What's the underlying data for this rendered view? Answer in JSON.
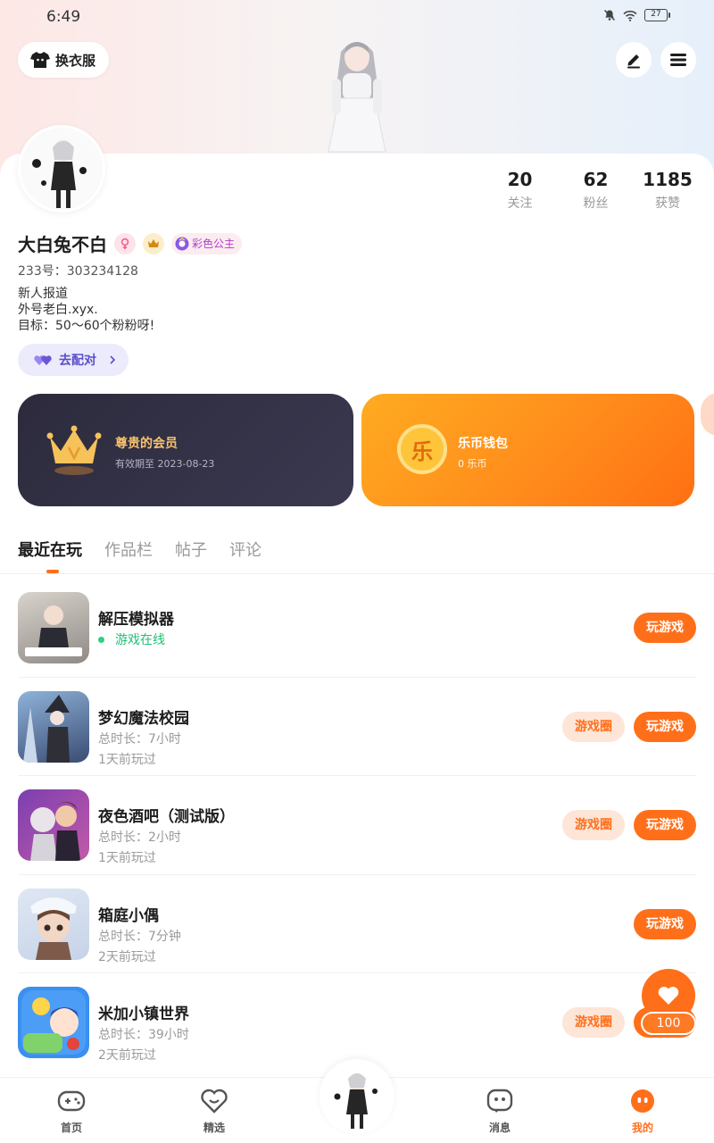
{
  "status_bar": {
    "time": "6:49",
    "battery": "27"
  },
  "header": {
    "outfit_label": "换衣服"
  },
  "profile": {
    "stats": [
      {
        "num": "20",
        "label": "关注"
      },
      {
        "num": "62",
        "label": "粉丝"
      },
      {
        "num": "1185",
        "label": "获赞"
      }
    ],
    "username": "大白兔不白",
    "princess_badge": "彩色公主",
    "uid": "233号：303234128",
    "bio": [
      "新人报道",
      "外号老白.xyx.",
      "目标：50～60个粉粉呀!"
    ],
    "pair_label": "去配对"
  },
  "cards": {
    "vip": {
      "title": "尊贵的会员",
      "sub": "有效期至 2023-08-23"
    },
    "wallet": {
      "title": "乐币钱包",
      "sub": "0 乐币",
      "coin_char": "乐"
    }
  },
  "tabs": [
    "最近在玩",
    "作品栏",
    "帖子",
    "评论"
  ],
  "games": [
    {
      "name": "解压模拟器",
      "online": "游戏在线",
      "play": "玩游戏"
    },
    {
      "name": "梦幻魔法校园",
      "duration": "总时长：7小时",
      "last": "1天前玩过",
      "circle": "游戏圈",
      "play": "玩游戏"
    },
    {
      "name": "夜色酒吧（测试版）",
      "duration": "总时长：2小时",
      "last": "1天前玩过",
      "circle": "游戏圈",
      "play": "玩游戏"
    },
    {
      "name": "箱庭小偶",
      "duration": "总时长：7分钟",
      "last": "2天前玩过",
      "play": "玩游戏"
    },
    {
      "name": "米加小镇世界",
      "duration": "总时长：39小时",
      "last": "2天前玩过",
      "circle": "游戏圈",
      "play": "玩游戏"
    }
  ],
  "float_like": {
    "count": "100"
  },
  "nav": {
    "home": "首页",
    "featured": "精选",
    "messages": "消息",
    "me": "我的"
  },
  "colors": {
    "accent": "#ff6f1a",
    "online": "#1fbf73",
    "vip_bg": "#2c2a3c",
    "wallet_bg": "#ff8a1b"
  }
}
